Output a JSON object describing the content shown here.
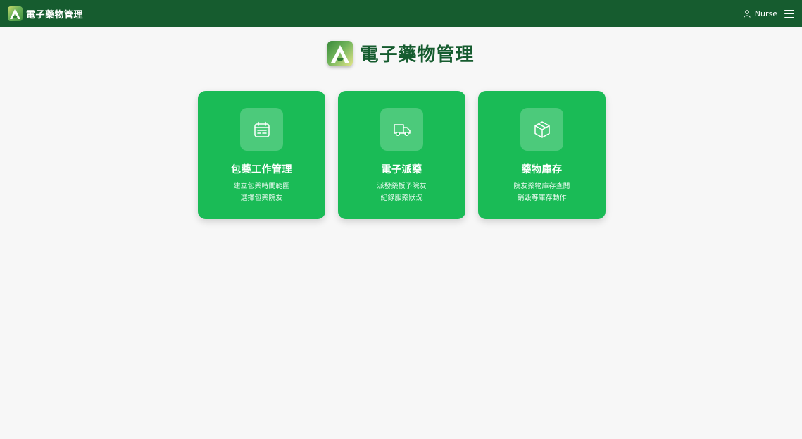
{
  "header": {
    "brand_title": "電子藥物管理",
    "user_name": "Nurse",
    "menu_icon": "hamburger-menu-icon",
    "user_icon": "user-icon"
  },
  "hero": {
    "title": "電子藥物管理"
  },
  "cards": [
    {
      "title": "包藥工作管理",
      "desc_line1": "建立包藥時間範圍",
      "desc_line2": "選擇包藥院友",
      "icon": "calendar-icon"
    },
    {
      "title": "電子派藥",
      "desc_line1": "派發藥板予院友",
      "desc_line2": "紀錄服藥狀況",
      "icon": "truck-icon"
    },
    {
      "title": "藥物庫存",
      "desc_line1": "院友藥物庫存查閱",
      "desc_line2": "銷毀等庫存動作",
      "icon": "box-icon"
    }
  ],
  "colors": {
    "header_bg": "#165c2f",
    "card_bg": "#1abb56",
    "page_bg": "#f7f7f7",
    "title_color": "#165c2f"
  }
}
